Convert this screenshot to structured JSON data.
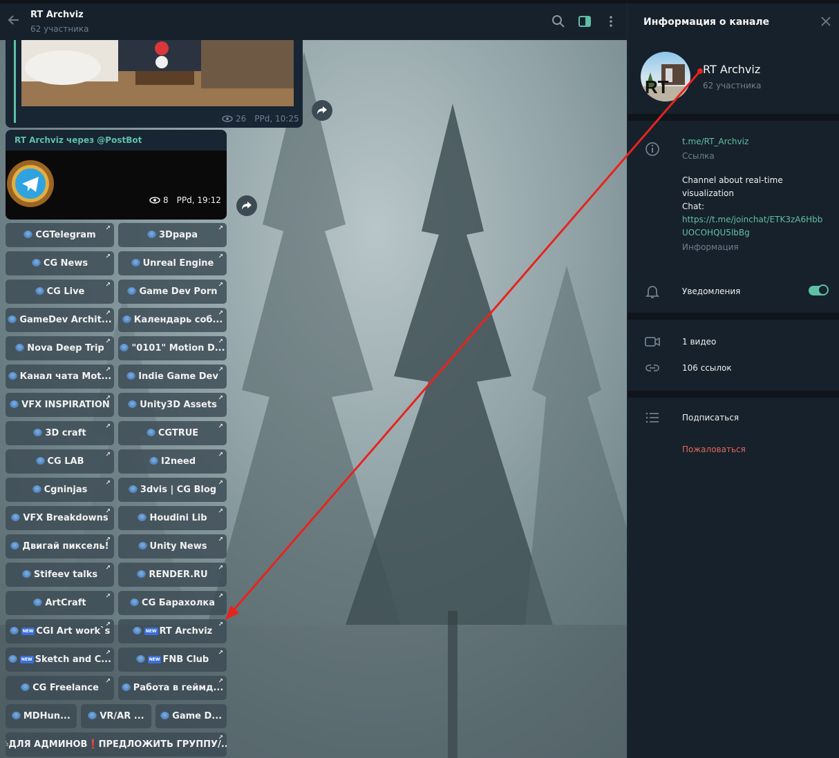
{
  "chat_header": {
    "title": "RT Archviz",
    "subtitle": "62 участника"
  },
  "messages": [
    {
      "views": "26",
      "time": "РРd, 10:25"
    },
    {
      "sender": "RT Archviz через @PostBot",
      "views": "8",
      "time": "РРd, 19:12"
    }
  ],
  "keyboard": [
    [
      "CGTelegram",
      "3Dpapa"
    ],
    [
      "CG News",
      "Unreal Engine"
    ],
    [
      "CG Live",
      "Game Dev Porn"
    ],
    [
      "GameDev Archit...",
      "Календарь соб..."
    ],
    [
      "Nova Deep Trip",
      "\"0101\" Motion D..."
    ],
    [
      "Канал чата Mot...",
      "Indie Game Dev"
    ],
    [
      "VFX INSPIRATION",
      "Unity3D Assets"
    ],
    [
      "3D craft",
      "CGTRUE"
    ],
    [
      "CG LAB",
      "I2need"
    ],
    [
      "Cgninjas",
      "3dvis | CG Blog"
    ],
    [
      "VFX Breakdowns",
      "Houdini Lib"
    ],
    [
      "Двигай пиксель!",
      "Unity News"
    ],
    [
      "Stifeev talks",
      "RENDER.RU"
    ],
    [
      "ArtCraft",
      "CG Барахолка"
    ],
    [
      "CGI Art work`s",
      "RT Archviz"
    ],
    [
      "Sketch and C...",
      "FNB Club"
    ],
    [
      "CG Freelance",
      "Работа в геймд..."
    ],
    [
      "MDHun...",
      "VR/AR ...",
      "Game D..."
    ],
    [
      "✍ДЛЯ АДМИНОВ❗ПРЕДЛОЖИТЬ ГРУППУ/..."
    ]
  ],
  "new_badge": "NEW",
  "panel": {
    "title": "Информация о канале",
    "name": "RT Archviz",
    "count": "62 участника",
    "avatar_text": "RT",
    "link": "t.me/RT_Archviz",
    "link_label": "Ссылка",
    "desc_line1": "Channel about real-time",
    "desc_line2": "visualization",
    "desc_line3": "Chat:",
    "desc_url1": "https://t.me/joinchat/ETK3zA6Hbb",
    "desc_url2": "UOCOHQU5lbBg",
    "desc_label": "Информация",
    "notifications": "Уведомления",
    "videos": "1 видео",
    "links": "106 ссылок",
    "subscribe": "Подписаться",
    "report": "Пожаловаться"
  },
  "colors": {
    "accent": "#5fc0a6",
    "panel_bg": "#17212b",
    "danger": "#e0665b",
    "annotation": "#e8231c"
  }
}
